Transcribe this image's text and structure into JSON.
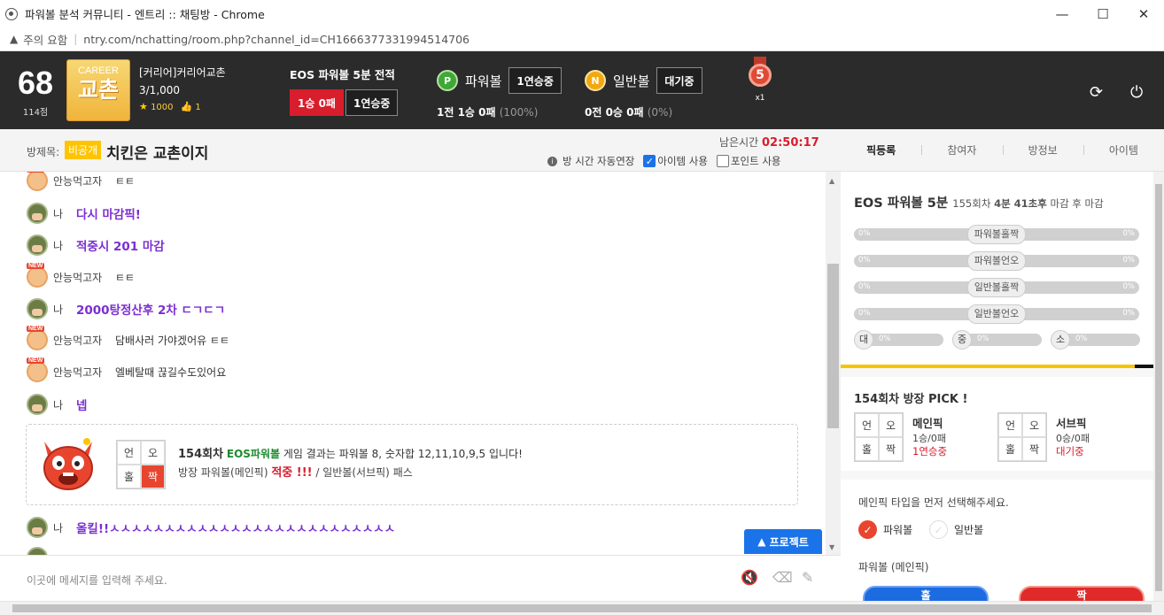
{
  "window": {
    "title": "파워볼 분석 커뮤니티 - 엔트리 :: 채팅방 - Chrome",
    "minimize": "—",
    "maximize": "☐",
    "close": "✕"
  },
  "address": {
    "warning": "주의 요함",
    "url": "ntry.com/nchatting/room.php?channel_id=CH1666377331994514706"
  },
  "user": {
    "level": "68",
    "points": "114점",
    "badge_top": "CAREER",
    "badge_main": "교촌",
    "name": "[커리어]커리어교촌",
    "count": "3/1,000",
    "stars": "1000",
    "likes": "1"
  },
  "eos": {
    "title": "EOS 파워볼 5분 전적",
    "record": "1승 0패",
    "streak": "1연승중"
  },
  "games": [
    {
      "coin": "P",
      "name": "파워볼",
      "status": "1연승중",
      "stat": "1전 1승 0패",
      "pct": "(100%)"
    },
    {
      "coin": "N",
      "name": "일반볼",
      "status": "대기중",
      "stat": "0전 0승 0패",
      "pct": "(0%)"
    }
  ],
  "medal": {
    "num": "5",
    "mult": "x1"
  },
  "room": {
    "label": "방제목:",
    "private": "비공개",
    "name": "치킨은 교촌이지",
    "remain_label": "남은시간",
    "remain_time": "02:50:17",
    "opt_auto": "방 시간 자동연장",
    "opt_item": "아이템 사용",
    "opt_point": "포인트 사용"
  },
  "tabs": [
    "픽등록",
    "참여자",
    "방정보",
    "아이템"
  ],
  "chat": [
    {
      "who": "안능먹고자",
      "text": "ㅌㅌ",
      "me": false
    },
    {
      "who": "나",
      "text": "다시 마감픽!",
      "me": true
    },
    {
      "who": "나",
      "text": "적중시 201 마감",
      "me": true
    },
    {
      "who": "안능먹고자",
      "text": "ㅌㅌ",
      "me": false
    },
    {
      "who": "나",
      "text": "2000탕정산후 2차 ㄷㄱㄷㄱ",
      "me": true
    },
    {
      "who": "안능먹고자",
      "text": "담배사러 가야겠어유 ㅌㅌ",
      "me": false
    },
    {
      "who": "안능먹고자",
      "text": "엘베탈때 끊길수도있어요",
      "me": false
    },
    {
      "who": "나",
      "text": "넵",
      "me": true
    }
  ],
  "result": {
    "grid": [
      "언",
      "오",
      "홀",
      "짝"
    ],
    "round": "154회차",
    "game": "EOS파워볼",
    "line1_rest": "게임 결과는 파워볼 8, 숫자합 12,11,10,9,5 입니다!",
    "line2_a": "방장 파워볼(메인픽)",
    "line2_hit": "적중 !!!",
    "line2_b": "/ 일반볼(서브픽)",
    "line2_pass": "패스"
  },
  "chat_after": {
    "who": "나",
    "text": "올킬!!ㅅㅅㅅㅅㅅㅅㅅㅅㅅㅅㅅㅅㅅㅅㅅㅅㅅㅅㅅㅅㅅㅅㅅㅅㅅㅅ"
  },
  "project_button": "프로젝트",
  "input_placeholder": "이곳에 메세지를 입력해 주세요.",
  "panel": {
    "title": "EOS 파워볼 5분",
    "round": "155회차",
    "time_pre": "4분 41초후",
    "time_post": "마감 후 마감",
    "bars": [
      {
        "label": "파워볼홀짝",
        "left": "0%",
        "right": "0%"
      },
      {
        "label": "파워볼언오",
        "left": "0%",
        "right": "0%"
      },
      {
        "label": "일반볼홀짝",
        "left": "0%",
        "right": "0%"
      },
      {
        "label": "일반볼언오",
        "left": "0%",
        "right": "0%"
      }
    ],
    "small_bars": [
      {
        "icon": "대",
        "pct": "0%"
      },
      {
        "icon": "중",
        "pct": "0%"
      },
      {
        "icon": "소",
        "pct": "0%"
      }
    ],
    "timer_progress": 0.94,
    "pick_title": "154회차 방장 PICK !",
    "main": {
      "grid": [
        "언",
        "오",
        "홀",
        "짝"
      ],
      "label": "메인픽",
      "record": "1승/0패",
      "status": "1연승중"
    },
    "sub": {
      "grid": [
        "언",
        "오",
        "홀",
        "짝"
      ],
      "label": "서브픽",
      "record": "0승/0패",
      "status": "대기중"
    },
    "question": "메인픽 타입을 먼저 선택해주세요.",
    "opt1": "파워볼",
    "opt2": "일반볼",
    "sub_title": "파워볼 (메인픽)",
    "btn_left": "홀",
    "btn_right": "짝"
  },
  "colors": {
    "accent_red": "#d81d2c",
    "accent_blue": "#1a73e8",
    "purple": "#7b2fd1",
    "header_bg": "#2b2b2b",
    "gold": "#f5c400"
  }
}
